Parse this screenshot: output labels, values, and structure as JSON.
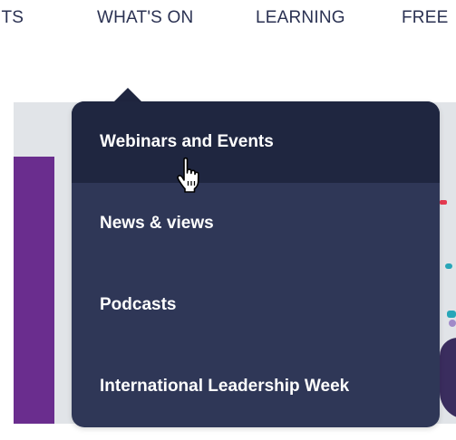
{
  "nav": {
    "items": [
      {
        "label": "ITS"
      },
      {
        "label": "WHAT'S ON"
      },
      {
        "label": "LEARNING"
      },
      {
        "label": "FREE"
      }
    ]
  },
  "dropdown": {
    "items": [
      {
        "label": "Webinars and Events",
        "state": "hovered"
      },
      {
        "label": "News & views"
      },
      {
        "label": "Podcasts"
      },
      {
        "label": "International Leadership Week"
      }
    ]
  },
  "colors": {
    "nav_text": "#2a3152",
    "dropdown_bg": "#2f3757",
    "dropdown_active_bg": "#1f2640",
    "menu_text": "#ffffff",
    "accent_purple": "#6a2d8e",
    "accent_yellow": "#f4d22a"
  },
  "cursor": {
    "icon": "hand-pointer-icon"
  }
}
